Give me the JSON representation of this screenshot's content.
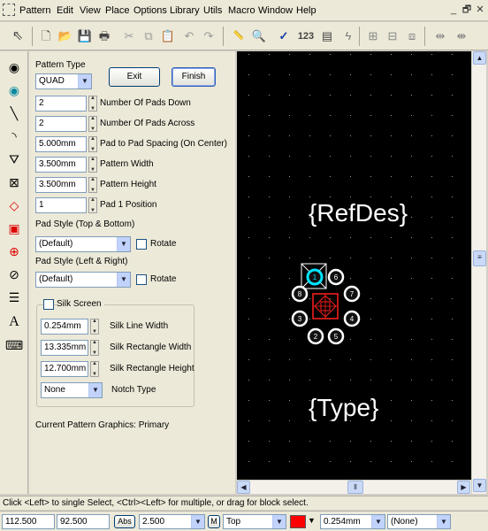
{
  "menu": {
    "items": [
      "Pattern",
      "Edit",
      "View",
      "Place",
      "Options",
      "Library",
      "Utils",
      "Macro",
      "Window",
      "Help"
    ],
    "window_buttons": [
      "_",
      "🗗",
      "✕"
    ]
  },
  "toolbar": {
    "number_label": "123"
  },
  "form": {
    "pattern_type_label": "Pattern Type",
    "pattern_type_value": "QUAD",
    "exit_label": "Exit",
    "finish_label": "Finish",
    "pads_down_value": "2",
    "pads_down_label": "Number Of Pads Down",
    "pads_across_value": "2",
    "pads_across_label": "Number Of Pads Across",
    "spacing_value": "5.000mm",
    "spacing_label": "Pad to Pad Spacing (On Center)",
    "width_value": "3.500mm",
    "width_label": "Pattern Width",
    "height_value": "3.500mm",
    "height_label": "Pattern Height",
    "pad1_value": "1",
    "pad1_label": "Pad 1 Position",
    "pad_style_tb_label": "Pad Style (Top & Bottom)",
    "pad_style_tb_value": "(Default)",
    "rotate_label_1": "Rotate",
    "pad_style_lr_label": "Pad Style (Left & Right)",
    "pad_style_lr_value": "(Default)",
    "rotate_label_2": "Rotate",
    "silk_screen_label": "Silk Screen",
    "silk_line_value": "0.254mm",
    "silk_line_label": "Silk Line Width",
    "silk_rect_w_value": "13.335mm",
    "silk_rect_w_label": "Silk Rectangle Width",
    "silk_rect_h_value": "12.700mm",
    "silk_rect_h_label": "Silk Rectangle Height",
    "notch_value": "None",
    "notch_label": "Notch Type",
    "current_graphics": "Current Pattern Graphics: Primary"
  },
  "canvas": {
    "refdes": "{RefDes}",
    "type": "{Type}",
    "pad_numbers": [
      "1",
      "6",
      "8",
      "7",
      "3",
      "4",
      "2",
      "5"
    ]
  },
  "status": {
    "text": "Click <Left> to single Select, <Ctrl><Left> for multiple, or drag for block select."
  },
  "bottom": {
    "x_coord": "112.500",
    "y_coord": "92.500",
    "abs_label": "Abs",
    "m_label": "M",
    "grid_value": "2.500",
    "layer_value": "Top",
    "line_width_value": "0.254mm",
    "none_value": "(None)"
  },
  "colors": {
    "layer_swatch": "#ff0000",
    "canvas_bg": "#000000"
  }
}
